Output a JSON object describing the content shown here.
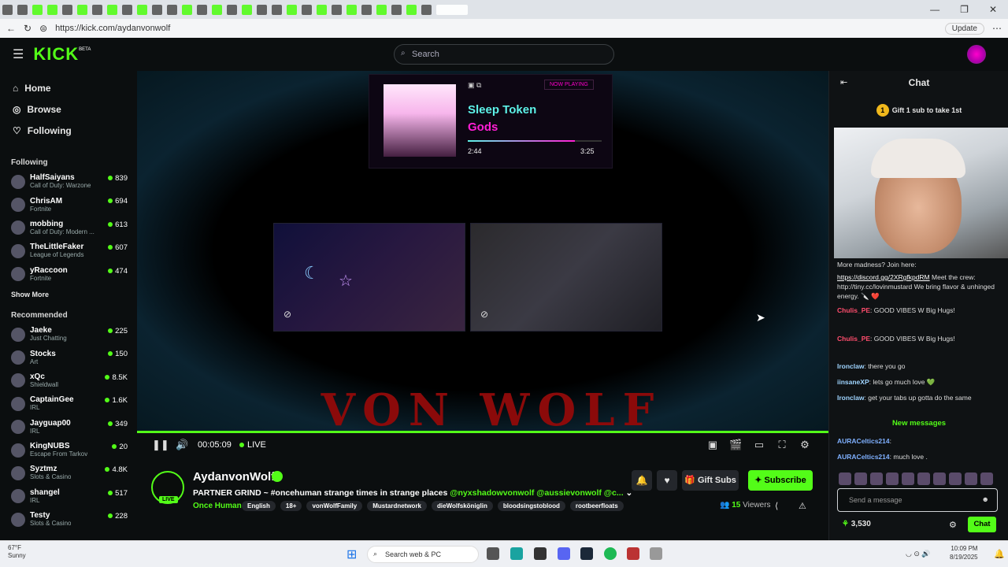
{
  "browser": {
    "url": "https://kick.com/aydanvonwolf",
    "update_label": "Update",
    "window_controls": [
      "—",
      "❐",
      "✕"
    ]
  },
  "header": {
    "logo": "KICK",
    "logo_badge": "BETA",
    "search_placeholder": "Search"
  },
  "sidebar": {
    "nav": [
      {
        "label": "Home",
        "icon": "home-icon"
      },
      {
        "label": "Browse",
        "icon": "compass-icon"
      },
      {
        "label": "Following",
        "icon": "heart-icon"
      }
    ],
    "following_title": "Following",
    "following": [
      {
        "name": "HalfSaiyans",
        "game": "Call of Duty: Warzone",
        "viewers": "839"
      },
      {
        "name": "ChrisAM",
        "game": "Fortnite",
        "viewers": "694"
      },
      {
        "name": "mobbing",
        "game": "Call of Duty: Modern ...",
        "viewers": "613"
      },
      {
        "name": "TheLittleFaker",
        "game": "League of Legends",
        "viewers": "607"
      },
      {
        "name": "yRaccoon",
        "game": "Fortnite",
        "viewers": "474"
      }
    ],
    "show_more": "Show More",
    "recommended_title": "Recommended",
    "recommended": [
      {
        "name": "Jaeke",
        "game": "Just Chatting",
        "viewers": "225"
      },
      {
        "name": "Stocks",
        "game": "Art",
        "viewers": "150"
      },
      {
        "name": "xQc",
        "game": "Shieldwall",
        "viewers": "8.5K"
      },
      {
        "name": "CaptainGee",
        "game": "IRL",
        "viewers": "1.6K"
      },
      {
        "name": "Jayguap00",
        "game": "IRL",
        "viewers": "349"
      },
      {
        "name": "KingNUBS",
        "game": "Escape From Tarkov",
        "viewers": "20"
      },
      {
        "name": "Syztmz",
        "game": "Slots & Casino",
        "viewers": "4.8K"
      },
      {
        "name": "shangel",
        "game": "IRL",
        "viewers": "517"
      },
      {
        "name": "Testy",
        "game": "Slots & Casino",
        "viewers": "228"
      }
    ]
  },
  "video": {
    "now_playing_tag": "NOW PLAYING",
    "song_artist": "Sleep Token",
    "song_title": "Gods",
    "elapsed": "2:44",
    "duration": "3:25",
    "song_progress": 0.8,
    "overlay_text": "VON WOLF",
    "stream_time": "00:05:09",
    "live_label": "LIVE",
    "accent": "#53fc18"
  },
  "stream": {
    "channel_name": "AydanvonWolf",
    "live_badge": "LIVE",
    "title_prefix": "PARTNER GRIND ~ #oncehuman strange times in strange places",
    "mentions": "@nyxshadowvonwolf  @aussievonwolf  @c...",
    "category": "Once Human",
    "tags": [
      "English",
      "18+",
      "vonWolfFamily",
      "Mustardnetwork",
      "dieWolfsköniglin",
      "bloodsingstoblood",
      "rootbeerfloats"
    ],
    "gift_label": "Gift Subs",
    "subscribe_label": "Subscribe",
    "viewers_count": "15",
    "viewers_label": "Viewers"
  },
  "chat": {
    "title": "Chat",
    "gift_prompt": "Gift 1 sub to take 1st",
    "gift_rank": "1",
    "messages": [
      {
        "user": "",
        "text": "More madness? Join here:",
        "color": "#ddd"
      },
      {
        "user": "",
        "link": "https://discord.gg/2XRgfkpdRM",
        "text": "Meet the crew: http://tiny.cc/lovinmustard We bring flavor & unhinged energy. 🔪 ❤️",
        "color": "#ddd"
      },
      {
        "user": "Chulis_PE",
        "text": "GOOD VIBES W Big Hugs!",
        "color": "#ff4d6d"
      },
      {
        "user": "Chulis_PE",
        "text": "GOOD VIBES W Big Hugs!",
        "color": "#ff4d6d"
      },
      {
        "user": "Ironclaw",
        "text": "there you go",
        "color": "#9fd4ff"
      },
      {
        "user": "iinsaneXP",
        "text": "lets go much love 💚",
        "color": "#9fd4ff"
      },
      {
        "user": "Ironclaw",
        "text": "get your tabs up gotta do the same",
        "color": "#9fd4ff"
      }
    ],
    "new_messages_label": "New messages",
    "recent": [
      {
        "user": "AURACeltics214",
        "text": "",
        "color": "#7fb0ff"
      },
      {
        "user": "AURACeltics214",
        "text": "much love .",
        "color": "#7fb0ff"
      }
    ],
    "input_placeholder": "Send a message",
    "points": "3,530",
    "send_label": "Chat"
  },
  "taskbar": {
    "temp": "67°F",
    "weather": "Sunny",
    "search_placeholder": "Search web & PC",
    "time": "10:09 PM",
    "date": "8/19/2025"
  }
}
